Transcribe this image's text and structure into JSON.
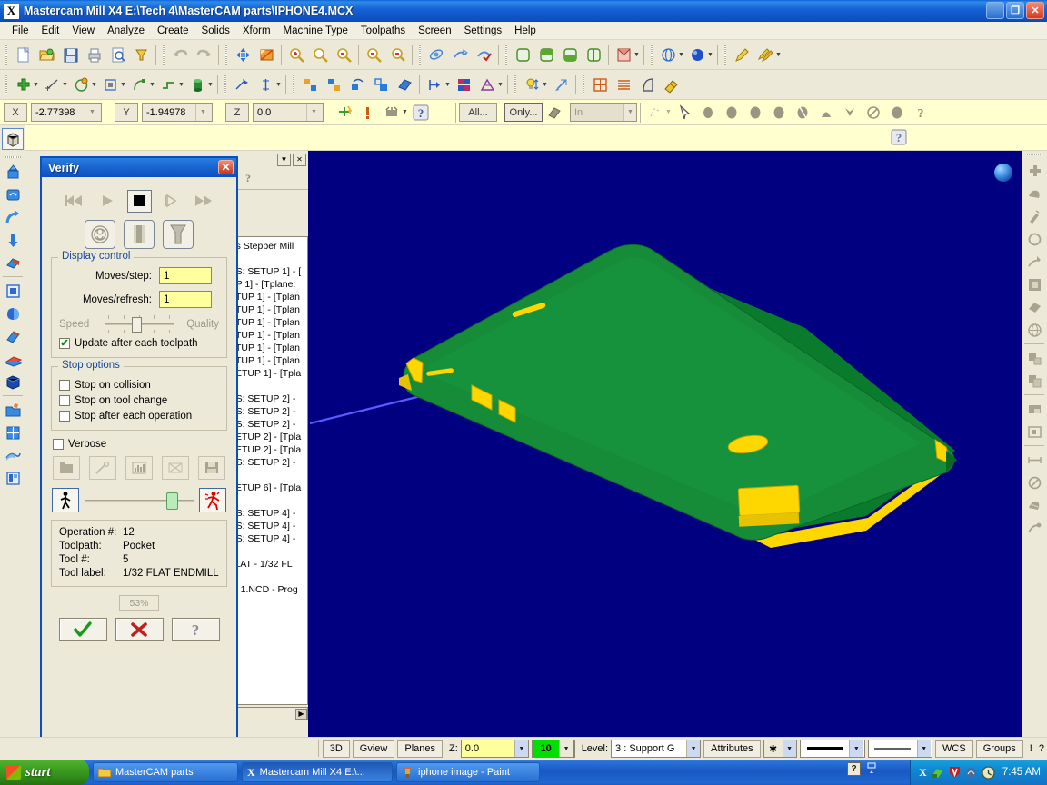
{
  "window": {
    "title": "Mastercam Mill X4  E:\\Tech 4\\MasterCAM parts\\IPHONE4.MCX",
    "app_icon": "mastercam-x-icon",
    "minimize": "_",
    "maximize": "❐",
    "close": "✕"
  },
  "menubar": {
    "items": [
      "File",
      "Edit",
      "View",
      "Analyze",
      "Create",
      "Solids",
      "Xform",
      "Machine Type",
      "Toolpaths",
      "Screen",
      "Settings",
      "Help"
    ]
  },
  "coordbar": {
    "x_label": "X",
    "x_value": "-2.77398",
    "y_label": "Y",
    "y_value": "-1.94978",
    "z_label": "Z",
    "z_value": "0.0",
    "all_button": "All...",
    "only_button": "Only...",
    "in_value": "In"
  },
  "toolpath_manager": {
    "tree_rows": [
      "xis Stepper Mill",
      "",
      "CS: SETUP 1] - [",
      "UP 1] - [Tplane:",
      "ETUP 1] - [Tplan",
      "ETUP 1] - [Tplan",
      "ETUP 1] - [Tplan",
      "ETUP 1] - [Tplan",
      "ETUP 1] - [Tplan",
      "ETUP 1] - [Tplan",
      "SETUP 1] - [Tpla",
      "",
      "CS: SETUP 2] -",
      "CS: SETUP 2] -",
      "CS: SETUP 2] -",
      "SETUP 2] - [Tpla",
      "SETUP 2] - [Tpla",
      "CS: SETUP 2] -",
      "",
      "SETUP 6] - [Tpla",
      "",
      "CS: SETUP 4] -",
      "CS: SETUP 4] -",
      "CS: SETUP 4] -",
      "",
      "FLAT -  1/32 FL",
      "",
      "IP 1.NCD - Prog"
    ]
  },
  "verify": {
    "title": "Verify",
    "close_label": "✕",
    "playback": {
      "rewind": "rewind-icon",
      "play": "play-icon",
      "stop": "stop-icon",
      "step": "step-icon",
      "fast_forward": "fast-forward-icon"
    },
    "modes": {
      "tool": "tool-mode-icon",
      "stock": "stock-mode-icon",
      "holder": "holder-mode-icon"
    },
    "display_control": {
      "legend": "Display control",
      "moves_step_label": "Moves/step:",
      "moves_step_value": "1",
      "moves_refresh_label": "Moves/refresh:",
      "moves_refresh_value": "1",
      "speed_label": "Speed",
      "quality_label": "Quality",
      "update_label": "Update after each toolpath",
      "update_checked": "✔"
    },
    "stop_options": {
      "legend": "Stop options",
      "items": [
        {
          "label": "Stop on collision",
          "checked": ""
        },
        {
          "label": "Stop on tool change",
          "checked": ""
        },
        {
          "label": "Stop after each operation",
          "checked": ""
        }
      ]
    },
    "verbose": {
      "label": "Verbose",
      "checked": ""
    },
    "tool_icons": [
      "configure-icon",
      "tool-profile-icon",
      "statistics-icon",
      "section-icon",
      "save-stock-icon"
    ],
    "run_controls": {
      "walk_icon": "walk-icon",
      "run_icon": "run-icon"
    },
    "info": {
      "operation_label": "Operation #:",
      "operation_value": "12",
      "toolpath_label": "Toolpath:",
      "toolpath_value": "Pocket",
      "tool_label": "Tool #:",
      "tool_value": "5",
      "tool_label_label": "Tool label:",
      "tool_label_value": "1/32 FLAT ENDMILL"
    },
    "progress": "53%",
    "buttons": {
      "ok": "✔",
      "cancel": "✖",
      "help": "?"
    }
  },
  "statusbar": {
    "view_3d": "3D",
    "gview": "Gview",
    "planes": "Planes",
    "z_label": "Z:",
    "z_value": "0.0",
    "color_value": "10",
    "level_label": "Level:",
    "level_value": "3 : Support G",
    "attributes": "Attributes",
    "point_style": "✱",
    "wcs": "WCS",
    "groups": "Groups",
    "alert": "!",
    "help": "?"
  },
  "taskbar": {
    "start": "start",
    "items": [
      {
        "label": "MasterCAM parts",
        "icon": "folder-icon",
        "active": "false"
      },
      {
        "label": "Mastercam Mill X4  E:\\...",
        "icon": "mastercam-x-icon",
        "active": "true"
      },
      {
        "label": "iphone image - Paint",
        "icon": "paint-icon",
        "active": "false"
      }
    ],
    "clock": "7:45 AM",
    "tray_icons": [
      "mastercam-tray-icon",
      "nvidia-icon",
      "antivirus-icon",
      "network-icon",
      "clock-tray-icon"
    ]
  },
  "colors": {
    "graphics_background": "#000080",
    "stock_green": "#1a8c3c",
    "machined_yellow": "#ffd700",
    "toolpath_blue": "#5a5aff",
    "field_yellow": "#ffff9e",
    "title_blue": "#0d4fc0"
  }
}
